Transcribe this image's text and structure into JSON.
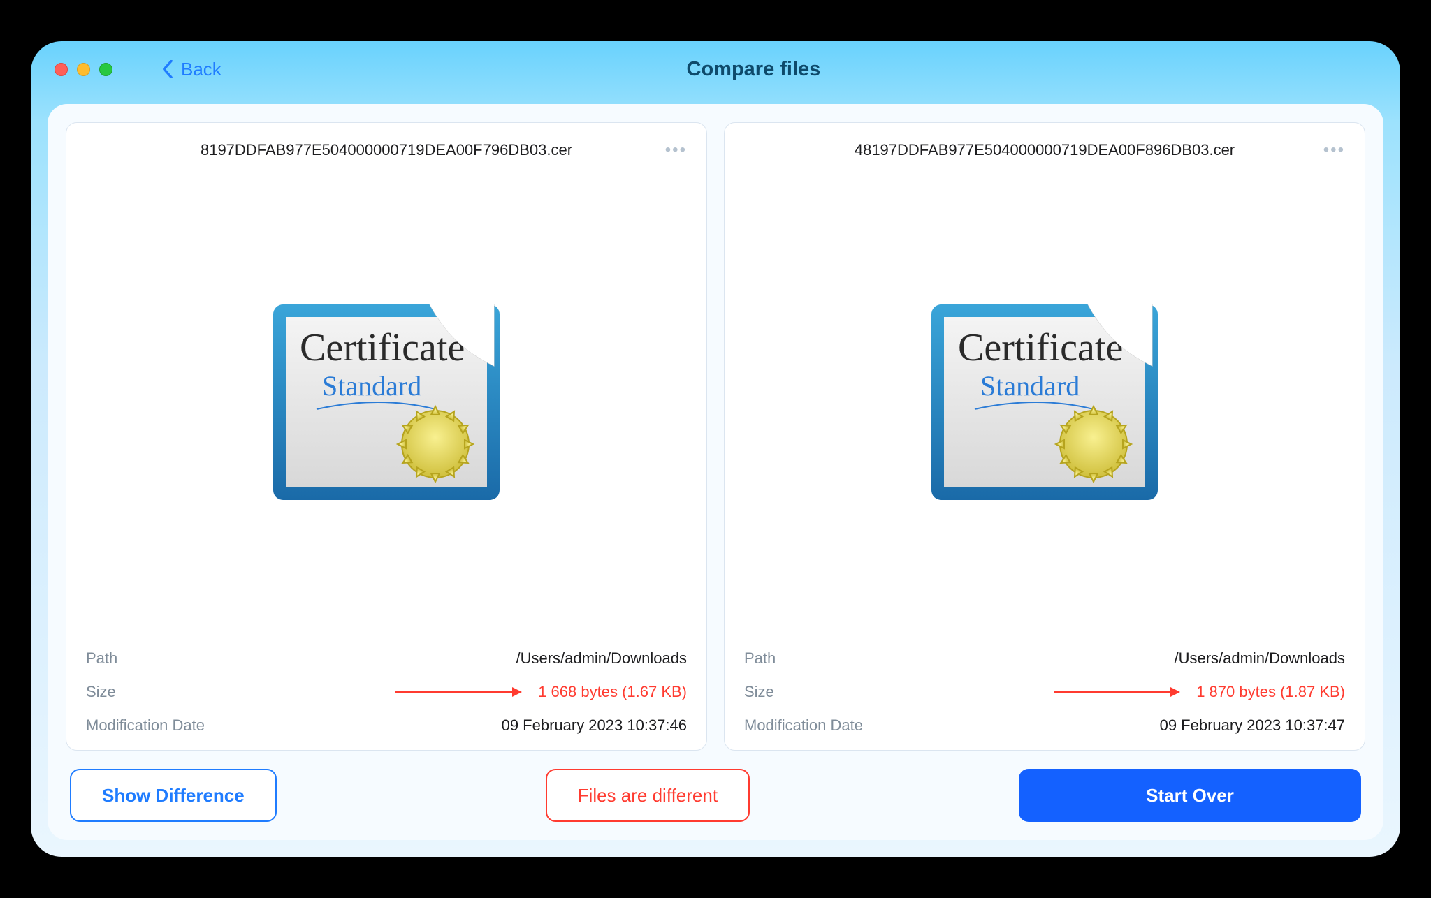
{
  "header": {
    "back_label": "Back",
    "title": "Compare files"
  },
  "left": {
    "filename": "8197DDFAB977E504000000719DEA00F796DB03.cer",
    "icon_text1": "Certificate",
    "icon_text2": "Standard",
    "path_label": "Path",
    "path_value": "/Users/admin/Downloads",
    "size_label": "Size",
    "size_value": "1 668 bytes (1.67 KB)",
    "mod_label": "Modification Date",
    "mod_value": "09 February 2023 10:37:46"
  },
  "right": {
    "filename": "48197DDFAB977E504000000719DEA00F896DB03.cer",
    "icon_text1": "Certificate",
    "icon_text2": "Standard",
    "path_label": "Path",
    "path_value": "/Users/admin/Downloads",
    "size_label": "Size",
    "size_value": "1 870 bytes (1.87 KB)",
    "mod_label": "Modification Date",
    "mod_value": "09 February 2023 10:37:47"
  },
  "actions": {
    "show_diff": "Show Difference",
    "status": "Files are different",
    "start_over": "Start Over"
  },
  "more_glyph": "•••"
}
